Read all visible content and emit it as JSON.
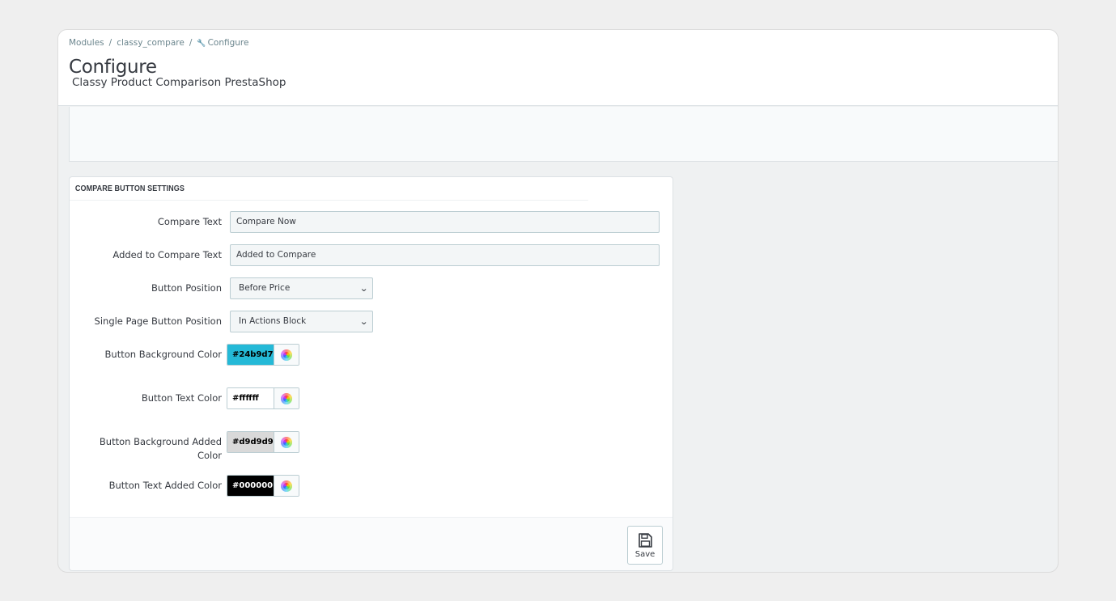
{
  "breadcrumb": {
    "items": [
      "Modules",
      "classy_compare",
      "Configure"
    ],
    "separator": "/"
  },
  "page": {
    "title": "Configure",
    "subtitle": "Classy Product Comparison PrestaShop"
  },
  "panel": {
    "heading": "COMPARE BUTTON SETTINGS",
    "fields": {
      "compare_text": {
        "label": "Compare Text",
        "value": "Compare Now"
      },
      "added_text": {
        "label": "Added to Compare Text",
        "value": "Added to Compare"
      },
      "button_position": {
        "label": "Button Position",
        "value": "Before Price"
      },
      "single_position": {
        "label": "Single Page Button Position",
        "value": "In Actions Block"
      },
      "bg_color": {
        "label": "Button Background Color",
        "value": "#24b9d7",
        "bg": "#24b9d7",
        "fg": "#000000"
      },
      "text_color": {
        "label": "Button Text Color",
        "value": "#ffffff",
        "bg": "#ffffff",
        "fg": "#000000"
      },
      "bg_added_color": {
        "label": "Button Background Added Color",
        "value": "#d9d9d9",
        "bg": "#d9d9d9",
        "fg": "#000000"
      },
      "text_added_color": {
        "label": "Button Text Added Color",
        "value": "#000000",
        "bg": "#000000",
        "fg": "#ffffff"
      }
    },
    "save_label": "Save"
  },
  "icons": {
    "breadcrumb_wrench": "wrench-icon",
    "select_chevron": "chevron-down-icon",
    "color_picker": "color-wheel-icon",
    "save": "floppy-disk-icon"
  }
}
